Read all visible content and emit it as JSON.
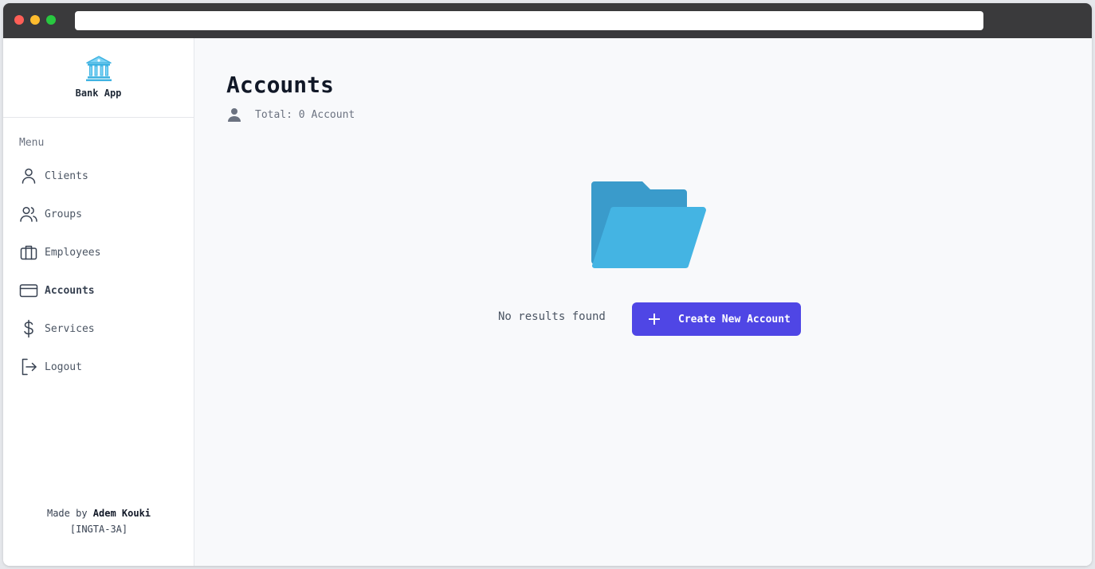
{
  "brand": {
    "name": "Bank App",
    "icon": "bank-icon"
  },
  "sidebar": {
    "menu_label": "Menu",
    "items": [
      {
        "label": "Clients",
        "icon": "user-icon"
      },
      {
        "label": "Groups",
        "icon": "users-icon"
      },
      {
        "label": "Employees",
        "icon": "briefcase-icon"
      },
      {
        "label": "Accounts",
        "icon": "credit-card-icon",
        "active": true
      },
      {
        "label": "Services",
        "icon": "dollar-icon"
      },
      {
        "label": "Logout",
        "icon": "logout-icon"
      }
    ],
    "footer": {
      "made_by": "Made by",
      "author": "Adem Kouki",
      "class": "[INGTA-3A]"
    }
  },
  "main": {
    "title": "Accounts",
    "total": "Total: 0 Account",
    "empty": {
      "icon": "folder-icon",
      "message": "No results found",
      "create_label": "Create New Account"
    }
  },
  "colors": {
    "accent": "#4f46e5",
    "folder": "#3fb3e2",
    "background": "#f8f9fb"
  }
}
